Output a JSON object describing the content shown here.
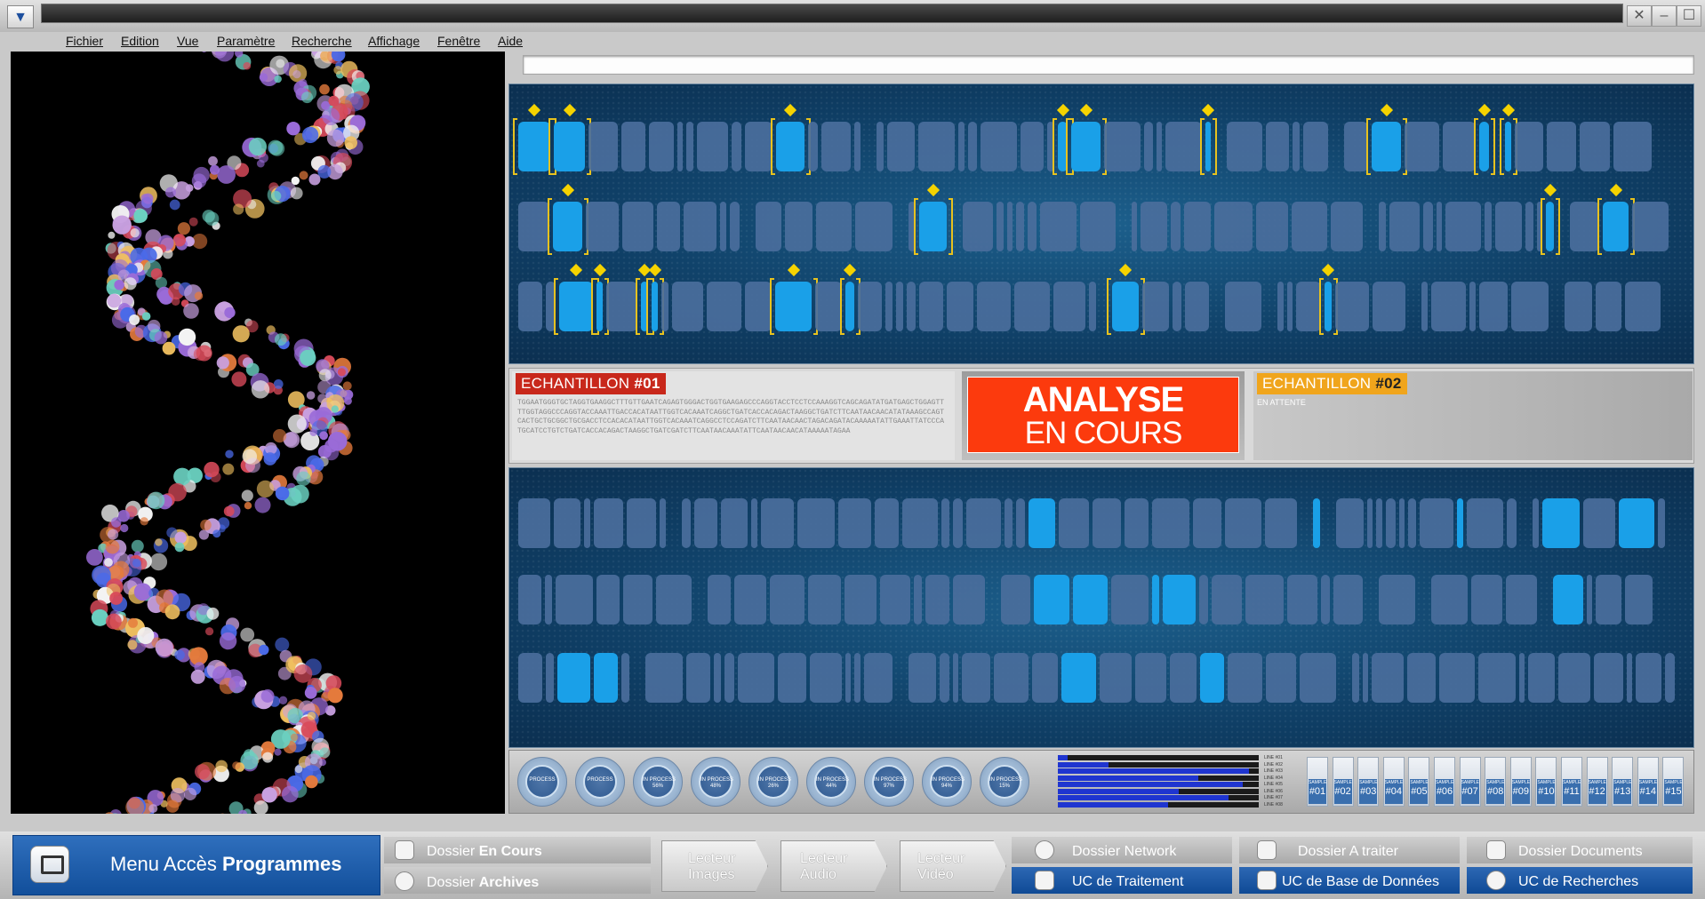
{
  "menu": [
    "Fichier",
    "Edition",
    "Vue",
    "Paramètre",
    "Recherche",
    "Affichage",
    "Fenêtre",
    "Aide"
  ],
  "sample1": {
    "label": "ECHANTILLON",
    "num": "#01",
    "sequence": "TGGAATGGGTGCTAGGTGAAGGCTTTGTTGAATCAGAGTGGGACTGGTGAAGAGCCCAGGTACCTCCTCCAAAGGTCAGCAGATATGATGAGCTGGAGTTTTGGTAGGCCCAGGTACCAAATTGACCACATAATTGGTCACAAATCAGGCTGATCACCACAGACTAAGGCTGATCTTCAATAACAACATATAAAGCCAGTCACTGCTGCGGCTGCGACCTCCACACATAATTGGTCACAAATCAGGCCTCCAGATCTTCAATAACAACTAGACAGATACAAAAATATTGAAATTATCCCATGCATCCTGTCTGATCACCACAGACTAAGGCTGATCGATCTTCAATAACAAATATTCAATAACAACATAAAAATAGAA"
  },
  "analyse": {
    "line1": "ANALYSE",
    "line2": "EN COURS"
  },
  "sample2": {
    "label": "ECHANTILLON",
    "num": "#02",
    "status": "EN ATTENTE"
  },
  "process": [
    {
      "l1": "PROCESS",
      "l2": ""
    },
    {
      "l1": "PROCESS",
      "l2": ""
    },
    {
      "l1": "IN PROCESS",
      "l2": "56%"
    },
    {
      "l1": "IN PROCESS",
      "l2": "48%"
    },
    {
      "l1": "IN PROCESS",
      "l2": "26%"
    },
    {
      "l1": "IN PROCESS",
      "l2": "44%"
    },
    {
      "l1": "IN PROCESS",
      "l2": "97%"
    },
    {
      "l1": "IN PROCESS",
      "l2": "94%"
    },
    {
      "l1": "IN PROCESS",
      "l2": "15%"
    }
  ],
  "lines": [
    {
      "label": "LINE #01",
      "level": 0.05
    },
    {
      "label": "LINE #02",
      "level": 0.25
    },
    {
      "label": "LINE #03",
      "level": 0.95
    },
    {
      "label": "LINE #04",
      "level": 0.7
    },
    {
      "label": "LINE #05",
      "level": 0.92
    },
    {
      "label": "LINE #06",
      "level": 0.6
    },
    {
      "label": "LINE #07",
      "level": 0.85
    },
    {
      "label": "LINE #08",
      "level": 0.55
    }
  ],
  "samples": [
    "#01",
    "#02",
    "#03",
    "#04",
    "#05",
    "#06",
    "#07",
    "#08",
    "#09",
    "#10",
    "#11",
    "#12",
    "#13",
    "#14",
    "#15"
  ],
  "sample_small": "SAMPLE",
  "taskbar": {
    "menu_prefix": "Menu Accès ",
    "menu_bold": "Programmes",
    "dossier_en_cours_a": "Dossier ",
    "dossier_en_cours_b": "En Cours",
    "dossier_archives_a": "Dossier ",
    "dossier_archives_b": "Archives",
    "lecteur_images": "Lecteur\nImages",
    "lecteur_audio": "Lecteur\nAudio",
    "lecteur_video": "Lecteur\nVidéo",
    "dossier_network": "Dossier Network",
    "uc_traitement": "UC de Traitement",
    "dossier_a_traiter": "Dossier A traiter",
    "uc_bdd": "UC de Base de Données",
    "dossier_documents": "Dossier Documents",
    "uc_recherches": "UC de Recherches"
  },
  "colors": {
    "accent": "#fc3a0d",
    "sample1": "#c8281b",
    "sample2": "#f0a51c",
    "highlight": "#1aa0e8",
    "marker": "#f5d300"
  }
}
